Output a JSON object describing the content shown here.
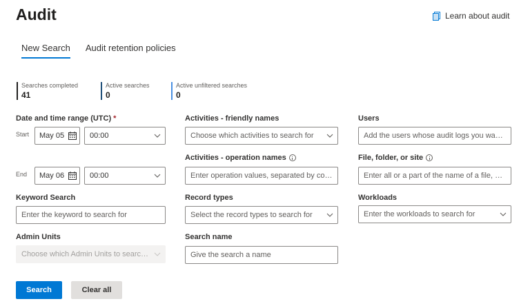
{
  "page": {
    "title": "Audit",
    "learn_link": "Learn about audit"
  },
  "tabs": [
    {
      "label": "New Search",
      "active": true
    },
    {
      "label": "Audit retention policies",
      "active": false
    }
  ],
  "stats": [
    {
      "label": "Searches completed",
      "value": "41",
      "color": "#201f1e"
    },
    {
      "label": "Active searches",
      "value": "0",
      "color": "#1f4e79"
    },
    {
      "label": "Active unfiltered searches",
      "value": "0",
      "color": "#4a90e2"
    }
  ],
  "date_range": {
    "label": "Date and time range (UTC)",
    "required_mark": "*",
    "start_label": "Start",
    "start_date": "May 05",
    "start_time": "00:00",
    "end_label": "End",
    "end_date": "May 06",
    "end_time": "00:00"
  },
  "keyword": {
    "label": "Keyword Search",
    "placeholder": "Enter the keyword to search for"
  },
  "admin_units": {
    "label": "Admin Units",
    "placeholder": "Choose which Admin Units to search for"
  },
  "activities_friendly": {
    "label": "Activities - friendly names",
    "placeholder": "Choose which activities to search for"
  },
  "activities_operation": {
    "label": "Activities - operation names",
    "placeholder": "Enter operation values, separated by commas"
  },
  "record_types": {
    "label": "Record types",
    "placeholder": "Select the record types to search for"
  },
  "search_name": {
    "label": "Search name",
    "placeholder": "Give the search a name"
  },
  "users": {
    "label": "Users",
    "placeholder": "Add the users whose audit logs you want to search"
  },
  "file_folder": {
    "label": "File, folder, or site",
    "placeholder": "Enter all or a part of the name of a file, website, or folder"
  },
  "workloads": {
    "label": "Workloads",
    "placeholder": "Enter the workloads to search for"
  },
  "buttons": {
    "search": "Search",
    "clear": "Clear all"
  },
  "icons": {
    "learn": "document-icon",
    "calendar": "calendar-icon",
    "chevron": "chevron-down-icon",
    "info": "info-icon"
  },
  "colors": {
    "accent": "#0078d4",
    "required": "#a4262c"
  }
}
